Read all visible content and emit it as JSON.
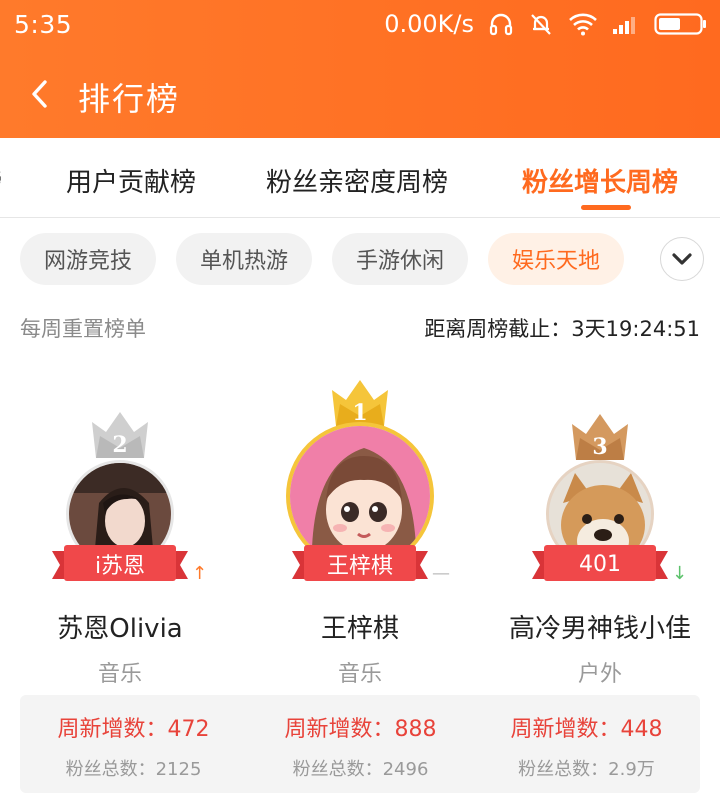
{
  "status": {
    "time": "5:35",
    "net_speed": "0.00K/s",
    "icons": [
      "headphones-icon",
      "bell-muted-icon",
      "wifi-icon",
      "signal-icon",
      "battery-icon"
    ]
  },
  "header": {
    "title": "排行榜",
    "back_icon": "chevron-left-icon"
  },
  "tabs": [
    {
      "label": "榜"
    },
    {
      "label": "用户贡献榜"
    },
    {
      "label": "粉丝亲密度周榜"
    },
    {
      "label": "粉丝增长周榜",
      "active": true
    }
  ],
  "categories": [
    {
      "label": "网游竞技"
    },
    {
      "label": "单机热游"
    },
    {
      "label": "手游休闲"
    },
    {
      "label": "娱乐天地",
      "active": true
    }
  ],
  "expand_icon": "chevron-down-icon",
  "info": {
    "reset_note": "每周重置榜单",
    "countdown": "距离周榜截止：3天19:24:51"
  },
  "podium": [
    {
      "rank": "2",
      "ribbon": "i苏恩",
      "name": "苏恩Olivia",
      "category": "音乐",
      "trend": "↑",
      "trend_color": "#ff7a2b",
      "weekly_new": "周新增数：472",
      "total_fans": "粉丝总数：2125",
      "crown_color": "#c9c9c9"
    },
    {
      "rank": "1",
      "ribbon": "王梓棋",
      "name": "王梓棋",
      "category": "音乐",
      "trend": "—",
      "trend_color": "#bdbdbd",
      "weekly_new": "周新增数：888",
      "total_fans": "粉丝总数：2496",
      "crown_color": "#f2c230"
    },
    {
      "rank": "3",
      "ribbon": "401",
      "name": "高冷男神钱小佳",
      "category": "户外",
      "trend": "↓",
      "trend_color": "#5cc26b",
      "weekly_new": "周新增数：448",
      "total_fans": "粉丝总数：2.9万",
      "crown_color": "#c98a55"
    }
  ],
  "colors": {
    "accent": "#ff6a1f",
    "ribbon": "#f0484a",
    "stat_red": "#e8433a"
  }
}
